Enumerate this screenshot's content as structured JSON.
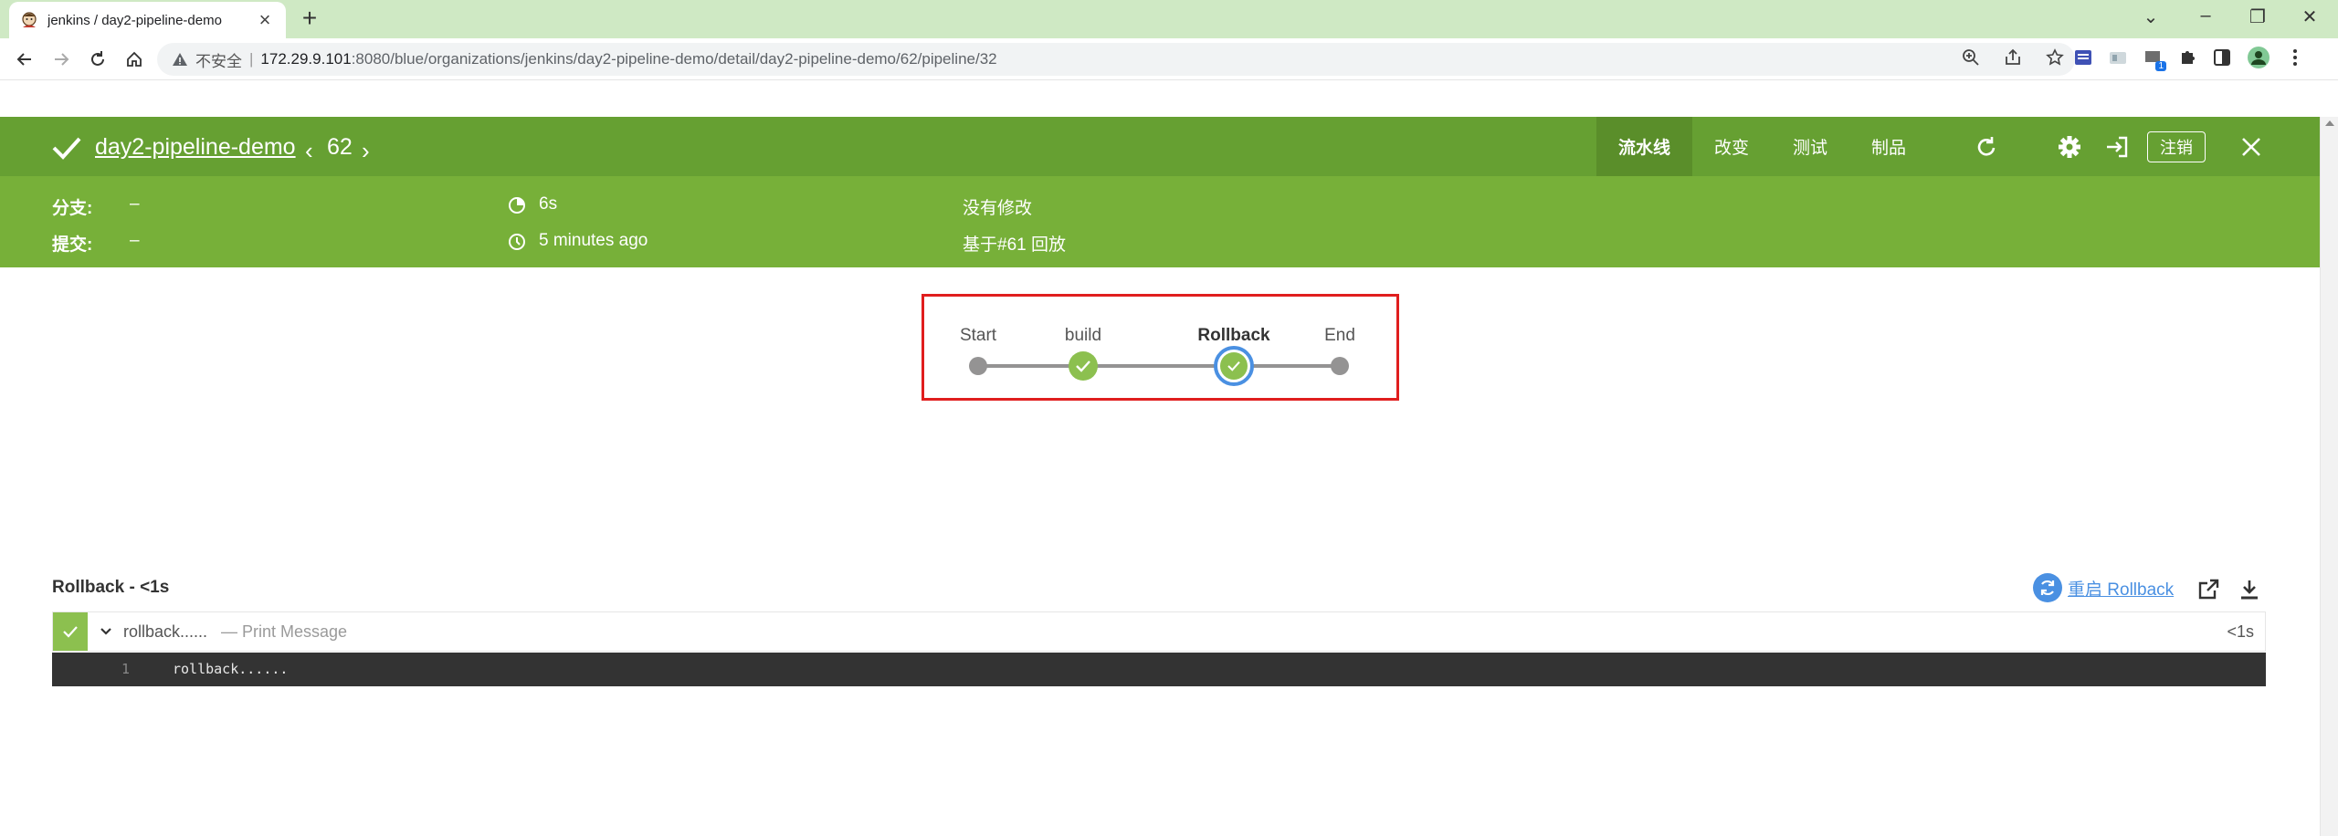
{
  "browser": {
    "tab_title": "jenkins / day2-pipeline-demo",
    "insecure_label": "不安全",
    "url_host": "172.29.9.101",
    "url_rest": ":8080/blue/organizations/jenkins/day2-pipeline-demo/detail/day2-pipeline-demo/62/pipeline/32",
    "new_tab": "+",
    "extension_badge": "1"
  },
  "header": {
    "pipeline_name": "day2-pipeline-demo",
    "run_number": "62",
    "tabs": [
      {
        "label": "流水线",
        "active": true
      },
      {
        "label": "改变",
        "active": false
      },
      {
        "label": "测试",
        "active": false
      },
      {
        "label": "制品",
        "active": false
      }
    ],
    "logout_label": "注销"
  },
  "meta": {
    "branch_label": "分支:",
    "branch_value": "–",
    "commit_label": "提交:",
    "commit_value": "–",
    "duration": "6s",
    "time_ago": "5 minutes ago",
    "changes": "没有修改",
    "replay_of": "基于#61 回放"
  },
  "pipeline_graph": {
    "stages": [
      {
        "name": "Start",
        "status": "start"
      },
      {
        "name": "build",
        "status": "success"
      },
      {
        "name": "Rollback",
        "status": "success",
        "selected": true
      },
      {
        "name": "End",
        "status": "end"
      }
    ]
  },
  "log": {
    "title": "Rollback - <1s",
    "restart_label": "重启 Rollback",
    "steps": [
      {
        "name": "rollback......",
        "description": "— Print Message",
        "duration": "<1s",
        "status": "success"
      }
    ],
    "console_lines": [
      {
        "number": "1",
        "text": "rollback......"
      }
    ]
  },
  "colors": {
    "header_dark": "#66a032",
    "header_light": "#77b039",
    "success": "#8cc04f",
    "selected_ring": "#4a90e2",
    "highlight_box": "#e01e1e"
  }
}
